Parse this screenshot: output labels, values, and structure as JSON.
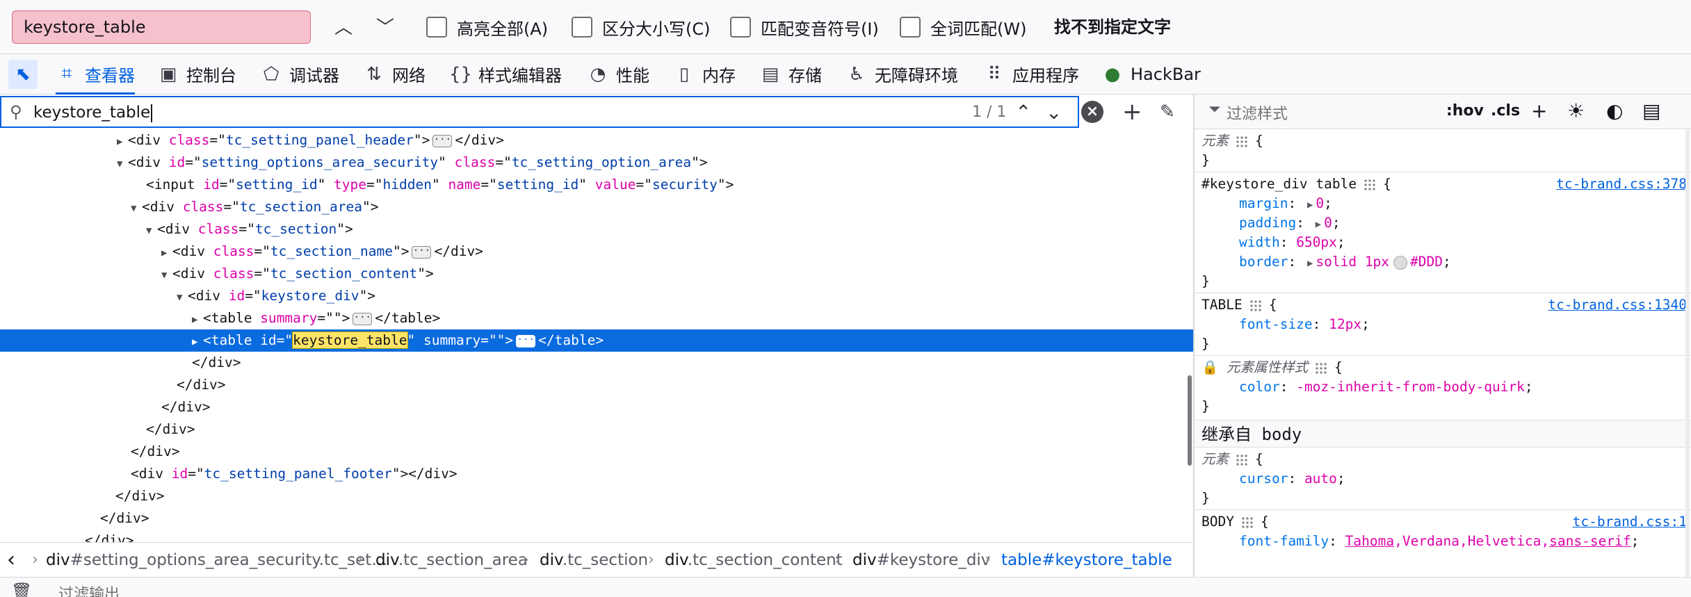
{
  "findbar": {
    "query": "keystore_table",
    "options": [
      "高亮全部(A)",
      "区分大小写(C)",
      "匹配变音符号(I)",
      "全词匹配(W)"
    ],
    "status": "找不到指定文字"
  },
  "tabs": [
    {
      "label": "查看器",
      "icon": "inspector-icon"
    },
    {
      "label": "控制台",
      "icon": "console-icon"
    },
    {
      "label": "调试器",
      "icon": "debugger-icon"
    },
    {
      "label": "网络",
      "icon": "network-icon"
    },
    {
      "label": "样式编辑器",
      "icon": "style-editor-icon"
    },
    {
      "label": "性能",
      "icon": "performance-icon"
    },
    {
      "label": "内存",
      "icon": "memory-icon"
    },
    {
      "label": "存储",
      "icon": "storage-icon"
    },
    {
      "label": "无障碍环境",
      "icon": "accessibility-icon"
    },
    {
      "label": "应用程序",
      "icon": "application-icon"
    },
    {
      "label": "HackBar",
      "icon": "hackbar-icon"
    }
  ],
  "markup_search": {
    "value": "keystore_table",
    "count": "1 / 1"
  },
  "markup": {
    "l1_attr": "class",
    "l1_val": "tc_setting_panel_header",
    "l2_attr1": "id",
    "l2_val1": "setting_options_area_security",
    "l2_attr2": "class",
    "l2_val2": "tc_setting_option_area",
    "l3_id": "setting_id",
    "l3_type": "hidden",
    "l3_name": "setting_id",
    "l3_value": "security",
    "l4_val": "tc_section_area",
    "l5_val": "tc_section",
    "l6_val": "tc_section_name",
    "l7_val": "tc_section_content",
    "l8_val": "keystore_div",
    "l9_attr": "summary",
    "l10_id": "keystore_table",
    "l14_val": "tc_setting_panel_footer"
  },
  "breadcrumbs": [
    {
      "tag": "div",
      "sel": "#setting_options_area_security.tc_set…"
    },
    {
      "tag": "div",
      "sel": ".tc_section_area"
    },
    {
      "tag": "div",
      "sel": ".tc_section"
    },
    {
      "tag": "div",
      "sel": ".tc_section_content"
    },
    {
      "tag": "div",
      "sel": "#keystore_div"
    },
    {
      "tag": "table",
      "sel": "#keystore_table"
    }
  ],
  "console": {
    "filter_placeholder": "过滤输出"
  },
  "rules_toolbar": {
    "filter_placeholder": "过滤样式",
    "hov": ":hov",
    "cls": ".cls"
  },
  "rules": {
    "element": "元素",
    "r2_selector": "#keystore_div table",
    "r2_source": "tc-brand.css:378",
    "r2_p1": "margin",
    "r2_v1": "0",
    "r2_p2": "padding",
    "r2_v2": "0",
    "r2_p3": "width",
    "r2_v3": "650px",
    "r2_p4": "border",
    "r2_v4a": "solid 1px",
    "r2_v4b": "#DDD",
    "r3_selector": "TABLE",
    "r3_source": "tc-brand.css:1340",
    "r3_p1": "font-size",
    "r3_v1": "12px",
    "r4_selector": "元素属性样式",
    "r4_p1": "color",
    "r4_v1": "-moz-inherit-from-body-quirk",
    "inherited_header": "继承自 body",
    "r5_p1": "cursor",
    "r5_v1": "auto",
    "r6_selector": "BODY",
    "r6_source": "tc-brand.css:1",
    "r6_p1": "font-family",
    "r6_v1": "Tahoma",
    "r6_v2": "Verdana",
    "r6_v3": "Helvetica",
    "r6_v4": "sans-serif"
  },
  "colors": {
    "accent": "#0061e0",
    "selection": "#0a6bdf",
    "find_not_found": "#f5c1cc",
    "attr_name": "#dd00a9",
    "attr_value": "#003eaa"
  }
}
